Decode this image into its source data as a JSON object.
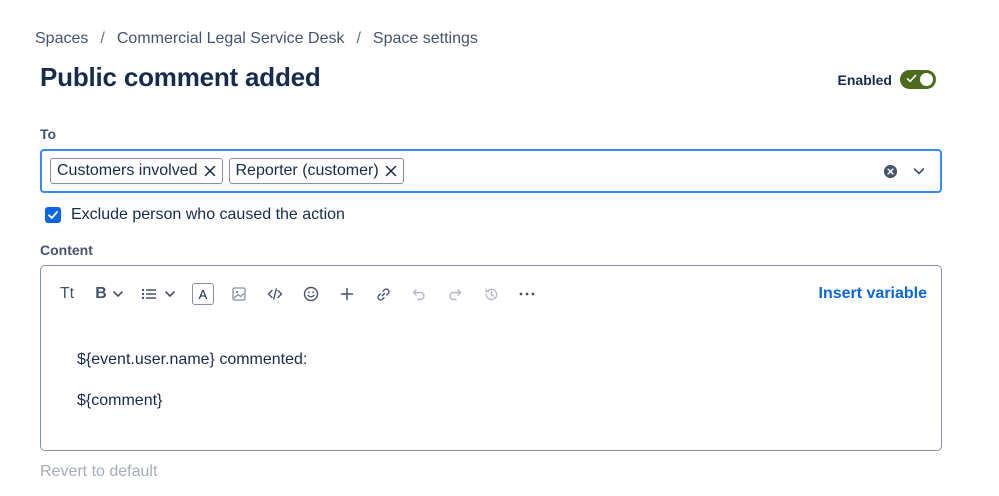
{
  "breadcrumb": {
    "items": [
      "Spaces",
      "Commercial Legal Service Desk",
      "Space settings"
    ],
    "separator": "/"
  },
  "title": "Public comment added",
  "enabled": {
    "label": "Enabled",
    "on": true,
    "color": "#4c6b1f"
  },
  "to": {
    "label": "To",
    "chips": [
      "Customers involved",
      "Reporter (customer)"
    ],
    "focus_color": "#388bff"
  },
  "exclude": {
    "label": "Exclude person who caused the action",
    "checked": true
  },
  "content": {
    "label": "Content",
    "toolbar": {
      "text_style": "Tt",
      "bold": "B",
      "text_color": "A",
      "insert_variable": "Insert variable",
      "icons": [
        "text-style-icon",
        "bold-icon",
        "chevron-down-icon",
        "list-icon",
        "chevron-down-icon",
        "text-color-icon",
        "image-icon",
        "code-icon",
        "emoji-icon",
        "plus-icon",
        "link-icon",
        "undo-icon",
        "redo-icon",
        "history-icon",
        "more-icon"
      ]
    },
    "lines": [
      "${event.user.name} commented:",
      "${comment}"
    ]
  },
  "revert": "Revert to default",
  "colors": {
    "link": "#0c66e4",
    "text": "#172b4d",
    "subtle": "#44546f",
    "disabled": "#a5adba"
  }
}
